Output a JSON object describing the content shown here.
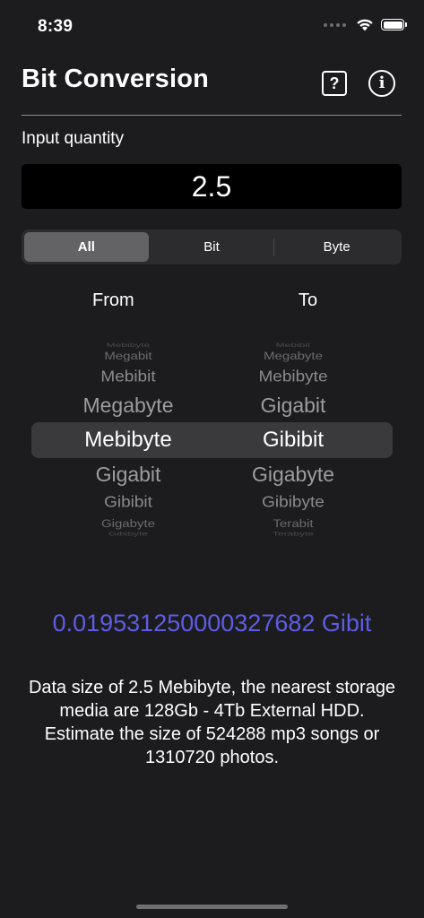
{
  "status_bar": {
    "time": "8:39",
    "icons": [
      "signal-dots-icon",
      "wifi-icon",
      "battery-icon"
    ]
  },
  "header": {
    "title": "Bit Conversion",
    "help_icon": "question-mark-square-icon",
    "help_glyph": "?",
    "info_icon": "info-circle-icon",
    "info_glyph": "i"
  },
  "input": {
    "label": "Input quantity",
    "value": "2.5"
  },
  "segments": {
    "items": [
      "All",
      "Bit",
      "Byte"
    ],
    "selected": "All"
  },
  "picker": {
    "from_label": "From",
    "to_label": "To",
    "from_items": [
      "Mebibyte",
      "Megabit",
      "Mebibit",
      "Megabyte",
      "Mebibyte",
      "Gigabit",
      "Gibibit",
      "Gigabyte",
      "Gibibyte"
    ],
    "to_items": [
      "Mebibit",
      "Megabyte",
      "Mebibyte",
      "Gigabit",
      "Gibibit",
      "Gigabyte",
      "Gibibyte",
      "Terabit",
      "Terabyte"
    ],
    "from_selected": "Mebibyte",
    "to_selected": "Gibibit"
  },
  "result": {
    "text": "0.019531250000327682 Gibit",
    "color": "#5e5ce6"
  },
  "description": {
    "text": "Data size of 2.5 Mebibyte, the nearest storage media are 128Gb - 4Tb External HDD. Estimate the size of 524288 mp3 songs or 1310720 photos."
  },
  "colors": {
    "background": "#1c1c1e",
    "input_background": "#000000",
    "segment_background": "#2c2c2e",
    "segment_selected": "#636366",
    "accent": "#5e5ce6"
  }
}
